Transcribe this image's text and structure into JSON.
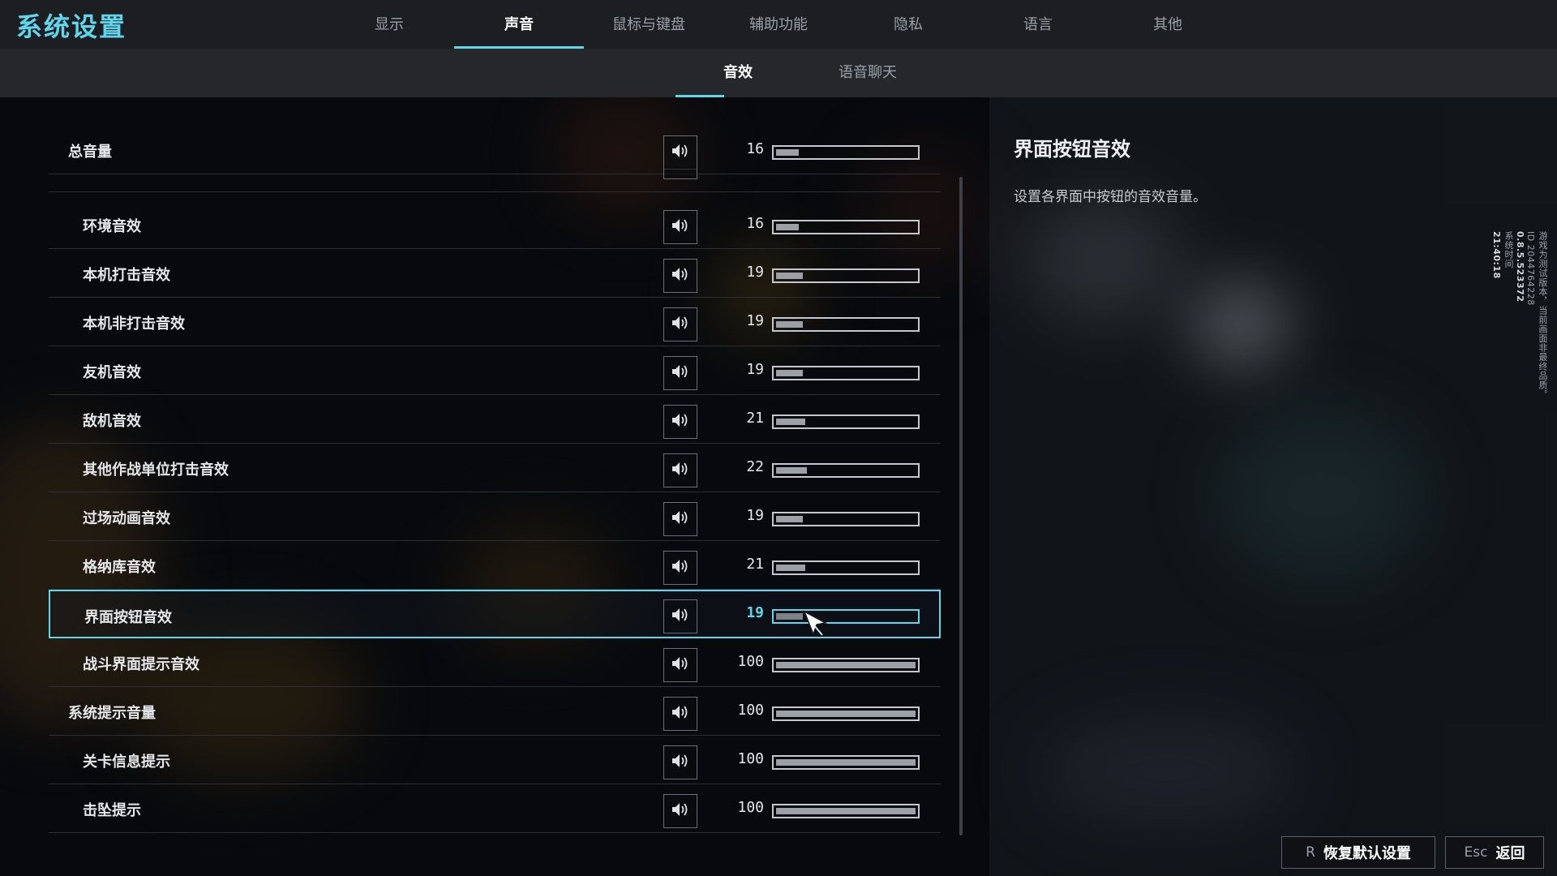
{
  "header": {
    "title": "系统设置",
    "tabs": [
      "显示",
      "声音",
      "鼠标与键盘",
      "辅助功能",
      "隐私",
      "语言",
      "其他"
    ],
    "active_tab": "声音"
  },
  "subtabs": {
    "items": [
      "音效",
      "语音聊天"
    ],
    "active": "音效"
  },
  "settings": [
    {
      "label": "总音量",
      "value": "16",
      "level": 0.16
    },
    {
      "label": "",
      "value": "",
      "level": 0
    },
    {
      "label": "环境音效",
      "value": "16",
      "level": 0.16
    },
    {
      "label": "本机打击音效",
      "value": "19",
      "level": 0.19
    },
    {
      "label": "本机非打击音效",
      "value": "19",
      "level": 0.19
    },
    {
      "label": "友机音效",
      "value": "19",
      "level": 0.19
    },
    {
      "label": "敌机音效",
      "value": "21",
      "level": 0.21
    },
    {
      "label": "其他作战单位打击音效",
      "value": "22",
      "level": 0.22
    },
    {
      "label": "过场动画音效",
      "value": "19",
      "level": 0.19
    },
    {
      "label": "格纳库音效",
      "value": "21",
      "level": 0.21
    },
    {
      "label": "界面按钮音效",
      "value": "19",
      "level": 0.19
    },
    {
      "label": "战斗界面提示音效",
      "value": "100",
      "level": 1.0
    },
    {
      "label": "系统提示音量",
      "value": "100",
      "level": 1.0
    },
    {
      "label": "关卡信息提示",
      "value": "100",
      "level": 1.0
    },
    {
      "label": "击坠提示",
      "value": "100",
      "level": 1.0
    }
  ],
  "selected_setting": "界面按钮音效",
  "description": {
    "title": "界面按钮音效",
    "text": "设置各界面中按钮的音效音量。"
  },
  "side_info": {
    "notice": "游戏为测试版本，当前画面非最终品质。",
    "id": "ID 2044764228",
    "version": "0.8.5.523372",
    "time_label": "系统时间",
    "time": "21:40:18"
  },
  "footer": {
    "reset_key": "R",
    "reset_label": "恢复默认设置",
    "back_key": "Esc",
    "back_label": "返回"
  },
  "colors": {
    "accent": "#5fd6ec",
    "header_bg": "#1c1e22",
    "subbar_bg": "#25272b"
  }
}
